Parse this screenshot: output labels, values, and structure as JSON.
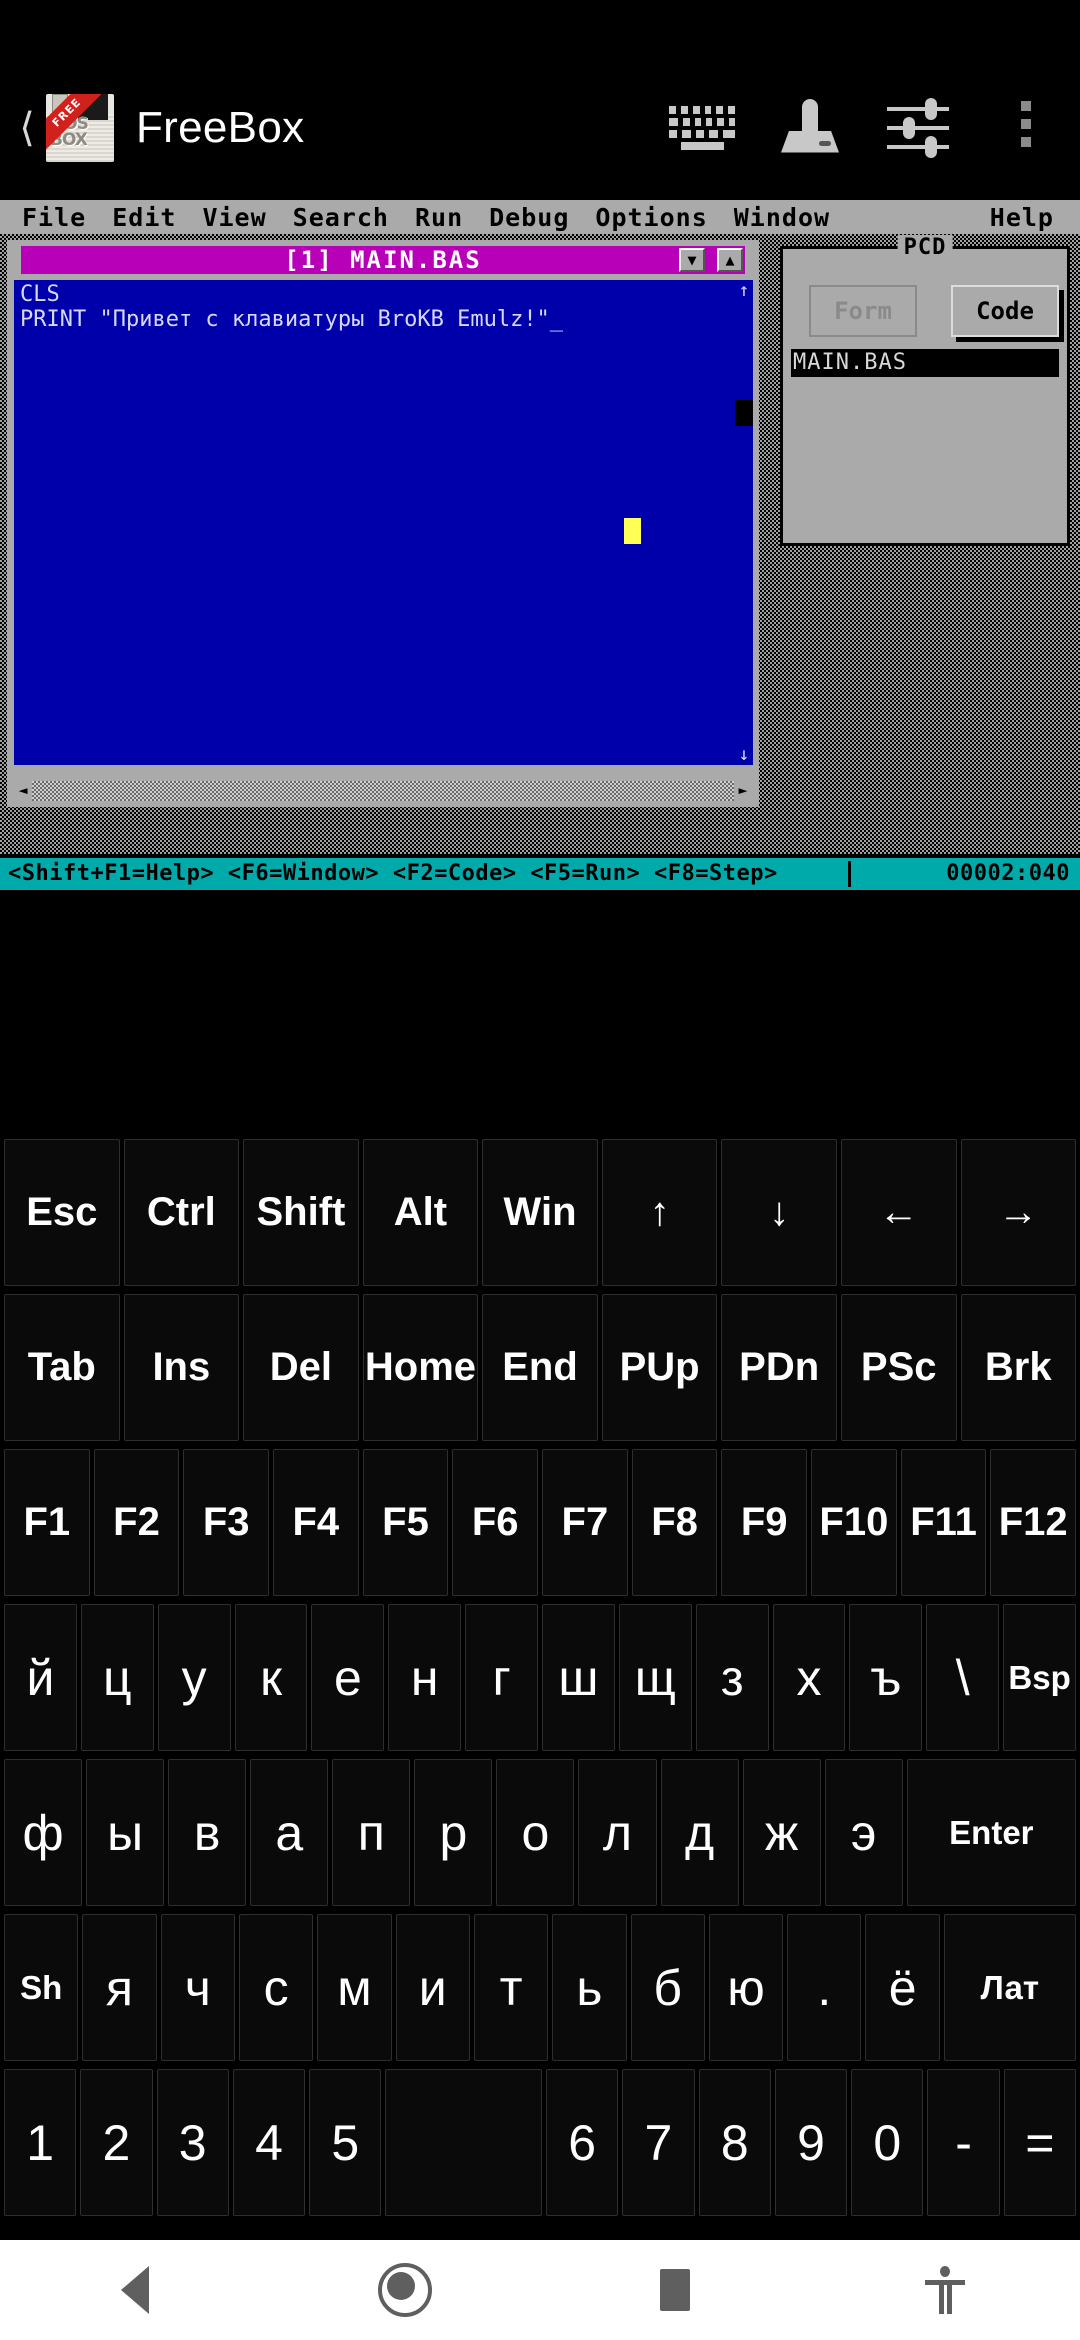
{
  "appbar": {
    "back_icon": "back-chevron-icon",
    "logo_text_line1": "DOS",
    "logo_text_line2": "BOX",
    "logo_badge": "FREE",
    "title": "FreeBox",
    "actions": [
      {
        "name": "keyboard-icon",
        "label": "keyboard"
      },
      {
        "name": "joystick-icon",
        "label": "joystick"
      },
      {
        "name": "sliders-icon",
        "label": "settings"
      },
      {
        "name": "overflow-menu-icon",
        "label": "more"
      }
    ]
  },
  "dos": {
    "menubar": [
      "File",
      "Edit",
      "View",
      "Search",
      "Run",
      "Debug",
      "Options",
      "Window"
    ],
    "menubar_right": "Help",
    "editor": {
      "title": "[1] MAIN.BAS",
      "scroll_down_glyph": "▼",
      "scroll_up_glyph": "▲",
      "vscroll_up": "↑",
      "vscroll_down": "↓",
      "hscroll_left": "◄",
      "hscroll_right": "►",
      "lines": [
        "CLS",
        "PRINT \"Привет с клавиатуры BroKB Emulz!\"_"
      ]
    },
    "pcd": {
      "legend": "PCD",
      "form_button": "Form",
      "code_button": "Code",
      "files": [
        "MAIN.BAS"
      ]
    },
    "statusbar": {
      "hints": "<Shift+F1=Help> <F6=Window> <F2=Code> <F5=Run> <F8=Step>",
      "position": "00002:040"
    }
  },
  "keyboard": {
    "rows": [
      {
        "name": "modifier-row",
        "keys": [
          "Esc",
          "Ctrl",
          "Shift",
          "Alt",
          "Win",
          "↑",
          "↓",
          "←",
          "→"
        ]
      },
      {
        "name": "editing-row",
        "keys": [
          "Tab",
          "Ins",
          "Del",
          "Home",
          "End",
          "PUp",
          "PDn",
          "PSc",
          "Brk"
        ]
      },
      {
        "name": "function-row",
        "keys": [
          "F1",
          "F2",
          "F3",
          "F4",
          "F5",
          "F6",
          "F7",
          "F8",
          "F9",
          "F10",
          "F11",
          "F12"
        ]
      },
      {
        "name": "cyrillic-top-row",
        "keys": [
          "й",
          "ц",
          "у",
          "к",
          "е",
          "н",
          "г",
          "ш",
          "щ",
          "з",
          "х",
          "ъ",
          "\\",
          "Bsp"
        ]
      },
      {
        "name": "cyrillic-home-row",
        "keys": [
          "ф",
          "ы",
          "в",
          "а",
          "п",
          "р",
          "о",
          "л",
          "д",
          "ж",
          "э",
          "Enter"
        ]
      },
      {
        "name": "cyrillic-bottom-row",
        "keys": [
          "Sh",
          "я",
          "ч",
          "с",
          "м",
          "и",
          "т",
          "ь",
          "б",
          "ю",
          ".",
          "ё",
          "Лат"
        ]
      },
      {
        "name": "number-row",
        "keys": [
          "1",
          "2",
          "3",
          "4",
          "5",
          "",
          "6",
          "7",
          "8",
          "9",
          "0",
          "-",
          "="
        ]
      }
    ]
  },
  "navbar": {
    "buttons": [
      {
        "name": "nav-back-button",
        "label": "Back"
      },
      {
        "name": "nav-home-button",
        "label": "Home"
      },
      {
        "name": "nav-recents-button",
        "label": "Recents"
      },
      {
        "name": "nav-accessibility-button",
        "label": "Accessibility"
      }
    ]
  },
  "colors": {
    "dos_blue": "#0000AA",
    "dos_magenta": "#B800B8",
    "dos_cyan": "#00AAAA",
    "dos_gray": "#AAAAAA",
    "cursor_yellow": "#FFFF55",
    "badge_red": "#D0211C"
  }
}
